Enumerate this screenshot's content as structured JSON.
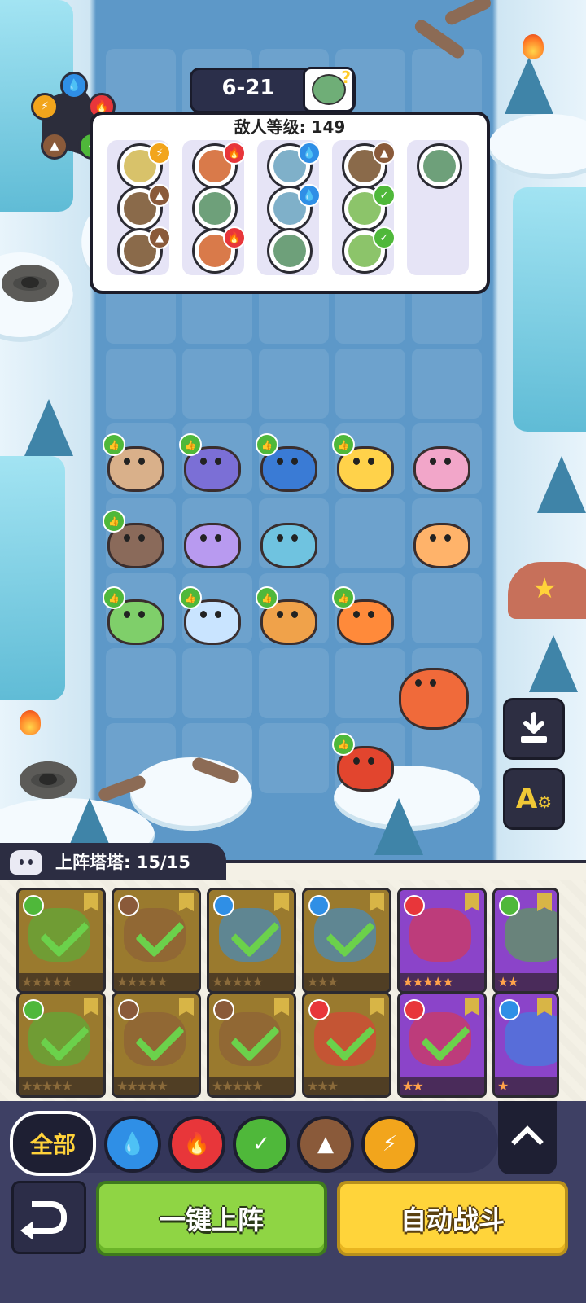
{
  "header": {
    "level": "6-21",
    "enemy_level_label": "敌人等级: 149"
  },
  "element_wheel": {
    "nodes": [
      "water",
      "fire",
      "grass",
      "earth",
      "lightning"
    ]
  },
  "enemy_columns": [
    {
      "enemies": [
        {
          "icon": "yellow-critter",
          "element": "lightning"
        },
        {
          "icon": "brown-hat-critter",
          "element": "earth"
        },
        {
          "icon": "dark-mushroom-critter",
          "element": "earth"
        }
      ]
    },
    {
      "enemies": [
        {
          "icon": "orange-critter",
          "element": "fire"
        },
        {
          "icon": "green-zombie-critter",
          "element": ""
        },
        {
          "icon": "red-crab-critter",
          "element": "fire"
        }
      ]
    },
    {
      "enemies": [
        {
          "icon": "blue-critter",
          "element": "water"
        },
        {
          "icon": "blue-zombie-critter",
          "element": "water"
        },
        {
          "icon": "teal-zombie-critter",
          "element": ""
        }
      ]
    },
    {
      "enemies": [
        {
          "icon": "brown-hat-critter",
          "element": "earth"
        },
        {
          "icon": "green-leaf-critter",
          "element": "grass"
        },
        {
          "icon": "green-bush-critter",
          "element": "grass"
        }
      ]
    },
    {
      "enemies": [
        {
          "icon": "teal-zombie-critter",
          "element": ""
        }
      ]
    }
  ],
  "board_units": [
    {
      "icon": "brown-hamster",
      "thumb": true
    },
    {
      "icon": "blue-crab",
      "thumb": true
    },
    {
      "icon": "toucan",
      "thumb": true
    },
    {
      "icon": "penguin-duck",
      "thumb": true
    },
    {
      "icon": "pink-mantis",
      "thumb": false
    },
    {
      "icon": "ferret",
      "thumb": true
    },
    {
      "icon": "purple-star-cat",
      "thumb": false
    },
    {
      "icon": "shell-crab",
      "thumb": false
    },
    {
      "icon": "orange-chick",
      "thumb": false
    },
    {
      "icon": "leaf-cat",
      "thumb": true
    },
    {
      "icon": "blue-lizard",
      "thumb": true
    },
    {
      "icon": "horned-fox",
      "thumb": true
    },
    {
      "icon": "tiger-cub",
      "thumb": true
    },
    {
      "icon": "red-panda",
      "thumb": false
    },
    {
      "icon": "fire-salamander",
      "thumb": true
    }
  ],
  "tools": {
    "download": "download-icon",
    "auto_settings": "auto-settings-icon"
  },
  "roster": {
    "label": "上阵塔塔: 15/15",
    "cards": [
      {
        "theme": "gold",
        "element": "grass",
        "deployed": true,
        "stars": "★★★★★"
      },
      {
        "theme": "gold",
        "element": "earth",
        "deployed": true,
        "stars": "★★★★★"
      },
      {
        "theme": "gold",
        "element": "water",
        "deployed": true,
        "stars": "★★★★★"
      },
      {
        "theme": "gold",
        "element": "water",
        "deployed": true,
        "stars": "★★★"
      },
      {
        "theme": "purple",
        "element": "fire",
        "deployed": false,
        "stars": "★★★★★"
      },
      {
        "theme": "purple",
        "element": "grass",
        "deployed": false,
        "stars": "★★"
      },
      {
        "theme": "gold",
        "element": "grass",
        "deployed": true,
        "stars": "★★★★★"
      },
      {
        "theme": "gold",
        "element": "earth",
        "deployed": true,
        "stars": "★★★★★"
      },
      {
        "theme": "gold",
        "element": "earth",
        "deployed": true,
        "stars": "★★★★★"
      },
      {
        "theme": "gold",
        "element": "fire",
        "deployed": true,
        "stars": "★★★"
      },
      {
        "theme": "purple",
        "element": "fire",
        "deployed": true,
        "stars": "★★"
      },
      {
        "theme": "purple",
        "element": "water",
        "deployed": false,
        "stars": "★"
      }
    ]
  },
  "filters": {
    "all_label": "全部",
    "elements": [
      "water",
      "fire",
      "grass",
      "earth",
      "lightning"
    ]
  },
  "colors": {
    "water": "#2f8fe6",
    "fire": "#e8363a",
    "grass": "#4fb83a",
    "earth": "#8a5a3a",
    "lightning": "#f2a51c"
  },
  "actions": {
    "deploy_all": "一键上阵",
    "auto_battle": "自动战斗"
  }
}
